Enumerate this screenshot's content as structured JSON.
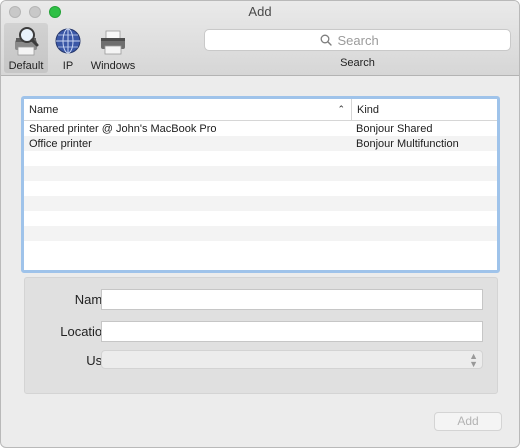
{
  "window": {
    "title": "Add"
  },
  "toolbar": {
    "tools": [
      {
        "label": "Default",
        "icon": "default-printer-magnifier-icon",
        "selected": true
      },
      {
        "label": "IP",
        "icon": "globe-network-icon",
        "selected": false
      },
      {
        "label": "Windows",
        "icon": "windows-printer-icon",
        "selected": false
      }
    ],
    "search": {
      "placeholder": "Search",
      "caption": "Search"
    }
  },
  "printer_table": {
    "columns": {
      "name": "Name",
      "kind": "Kind",
      "sort_indicator": "⌃"
    },
    "rows": [
      {
        "name": "Shared printer @ John's MacBook Pro",
        "kind": "Bonjour Shared"
      },
      {
        "name": "Office printer",
        "kind": "Bonjour Multifunction"
      }
    ],
    "empty_rows": 7
  },
  "form": {
    "name_label": "Name:",
    "name_value": "",
    "location_label": "Location:",
    "location_value": "",
    "use_label": "Use:",
    "use_value": ""
  },
  "buttons": {
    "add_label": "Add"
  },
  "colors": {
    "table_focus_ring": "#9fc3ea",
    "zoom_button": "#2fc046",
    "disabled_text": "#b3b3b3"
  }
}
